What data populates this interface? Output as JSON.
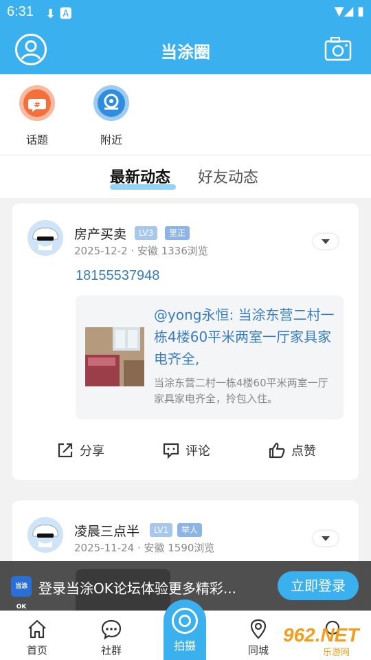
{
  "status_bar": {
    "time": "6:31"
  },
  "header": {
    "title": "当涂圈",
    "bg_color": "#3ab0ee"
  },
  "quick_entries": [
    {
      "label": "话题",
      "icon": "hashtag-chat-icon",
      "color": "#f36f3b"
    },
    {
      "label": "附近",
      "icon": "location-pin-icon",
      "color": "#2f8de0"
    }
  ],
  "tabs": [
    {
      "label": "最新动态",
      "active": true
    },
    {
      "label": "好友动态",
      "active": false
    }
  ],
  "posts": [
    {
      "username": "房产买卖",
      "level": "LV3",
      "badge": "里正",
      "meta": "2025-12-2 · 安徽  1336浏览",
      "content": "18155537948",
      "quote_title": "@yong永恒: 当涂东营二村一栋4楼60平米两室一厅家具家电齐全,",
      "quote_desc": "当涂东营二村一栋4楼60平米两室一厅家具家电齐全，拎包入住。",
      "actions": {
        "share": "分享",
        "comment": "评论",
        "like": "点赞"
      }
    },
    {
      "username": "凌晨三点半",
      "level": "LV1",
      "badge": "举人",
      "meta": "2025-11-24 · 安徽  1590浏览"
    }
  ],
  "login_banner": {
    "logo_text": "当涂OK",
    "text": "登录当涂OK论坛体验更多精彩...",
    "button": "立即登录"
  },
  "bottom_nav": [
    {
      "label": "首页",
      "icon": "home-icon"
    },
    {
      "label": "社群",
      "icon": "chat-bubble-icon"
    },
    {
      "label": "拍摄",
      "icon": "shoot-icon"
    },
    {
      "label": "同城",
      "icon": "location-pin-icon"
    }
  ],
  "watermark": {
    "text": "962.NET",
    "sub": "乐游网"
  }
}
